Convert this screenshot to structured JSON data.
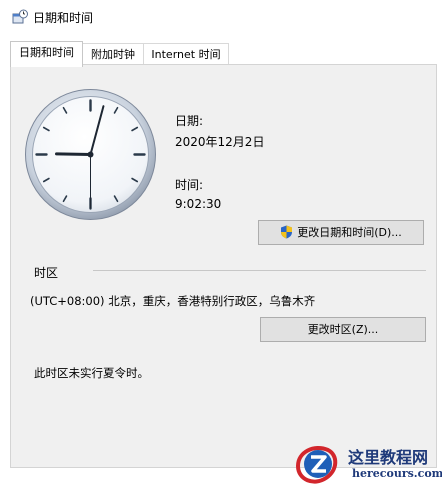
{
  "window": {
    "title": "日期和时间"
  },
  "tabs": [
    {
      "label": "日期和时间",
      "active": true
    },
    {
      "label": "附加时钟",
      "active": false
    },
    {
      "label": "Internet 时间",
      "active": false
    }
  ],
  "clock": {
    "display_time": "9:02:30"
  },
  "date": {
    "label": "日期:",
    "value": "2020年12月2日"
  },
  "time": {
    "label": "时间:",
    "value": "9:02:30"
  },
  "buttons": {
    "change_datetime": "更改日期和时间(D)...",
    "change_timezone": "更改时区(Z)..."
  },
  "timezone": {
    "header": "时区",
    "value": "(UTC+08:00) 北京，重庆，香港特别行政区，乌鲁木齐",
    "dst_note": "此时区未实行夏令时。"
  },
  "watermark": {
    "cn": "这里教程网",
    "en": "herecours.com"
  },
  "icons": {
    "title": "datetime-app-icon",
    "shield": "uac-shield-icon",
    "watermark_logo": "z-logo-icon"
  }
}
